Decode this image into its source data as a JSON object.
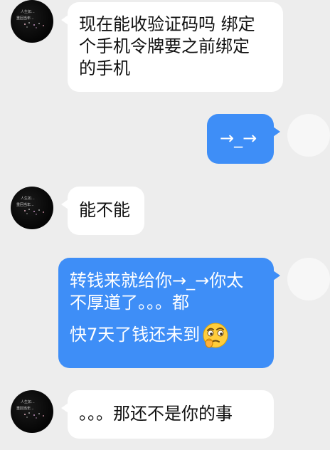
{
  "messages": [
    {
      "side": "in",
      "lines": [
        "现在能收验证码吗  绑定",
        "个手机令牌要之前绑定",
        "的手机"
      ]
    },
    {
      "side": "out",
      "lines": [
        "→_→"
      ]
    },
    {
      "side": "in",
      "lines": [
        "能不能"
      ]
    },
    {
      "side": "out",
      "lines": [
        "转钱来就给你→_→你太",
        "不厚道了。。。都",
        "快7天了钱还未到"
      ],
      "emoji": "thinking-face-emoji"
    },
    {
      "side": "in",
      "lines": [
        "。。。那还不是你的事"
      ]
    }
  ],
  "colors": {
    "background": "#ededed",
    "incoming_bubble": "#ffffff",
    "outgoing_bubble": "#3e8ef7",
    "incoming_text": "#111111",
    "outgoing_text": "#ffffff"
  }
}
